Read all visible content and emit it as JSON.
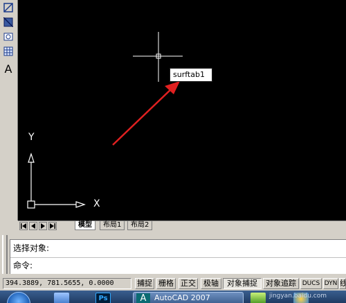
{
  "canvas": {
    "tooltip_text": "surftab1"
  },
  "ucs": {
    "y_label": "Y",
    "x_label": "X"
  },
  "layout_tabs": {
    "items": [
      {
        "label": "模型",
        "active": true
      },
      {
        "label": "布局1",
        "active": false
      },
      {
        "label": "布局2",
        "active": false
      }
    ]
  },
  "command_window": {
    "lines": [
      "选择对象:",
      "命令:"
    ]
  },
  "status_bar": {
    "coordinates": "394.3889,  781.5655,  0.0000",
    "buttons": [
      {
        "label": "捕捉",
        "on": false
      },
      {
        "label": "栅格",
        "on": false
      },
      {
        "label": "正交",
        "on": false
      },
      {
        "label": "极轴",
        "on": false
      },
      {
        "label": "对象捕捉",
        "on": true
      },
      {
        "label": "对象追踪",
        "on": false
      },
      {
        "label": "DUCS",
        "on": false
      },
      {
        "label": "DYN",
        "on": false
      },
      {
        "label": "线",
        "on": false
      }
    ]
  },
  "taskbar": {
    "active_app": "AutoCAD 2007",
    "watermark": "jingyan.baidu.com"
  },
  "toolbar": {
    "text_tool_glyph": "A"
  },
  "colors": {
    "canvas_bg": "#000000",
    "crosshair": "#ffffff",
    "arrow": "#e02020",
    "chrome": "#d4d0c8"
  }
}
